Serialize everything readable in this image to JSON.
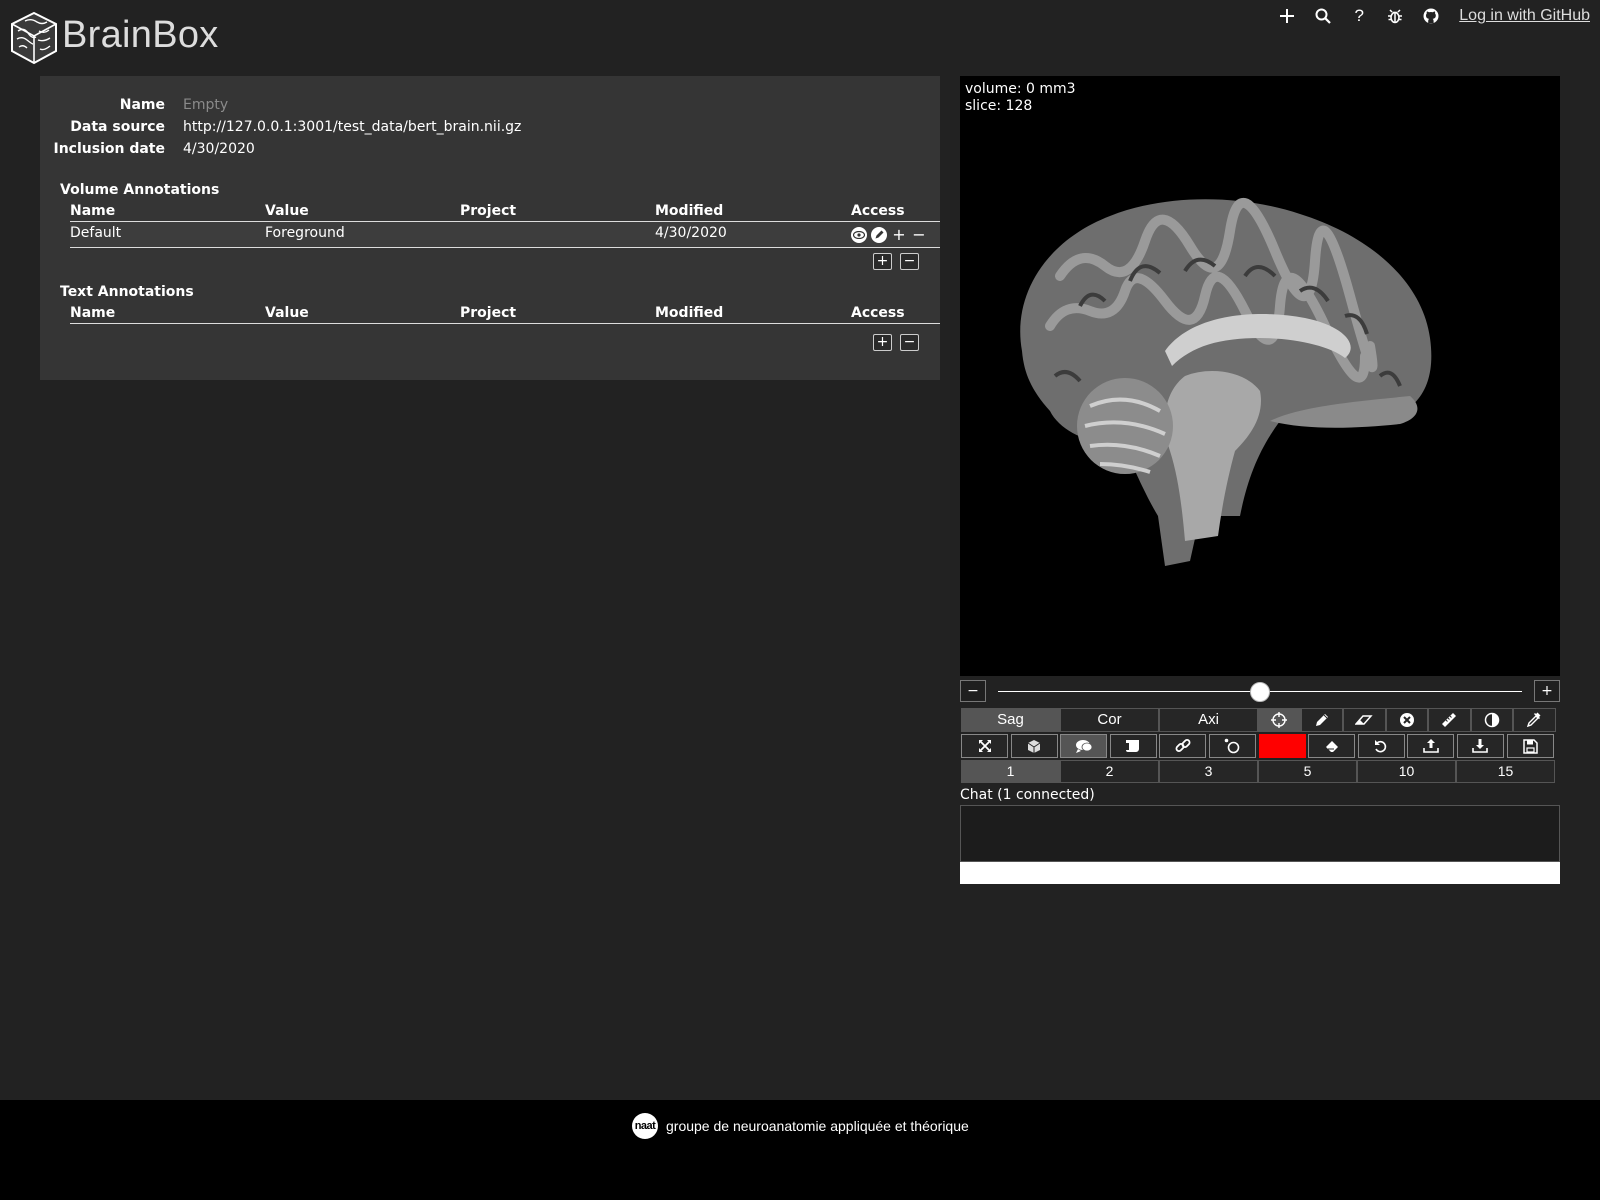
{
  "app": {
    "title": "BrainBox"
  },
  "header": {
    "icons": [
      "plus-icon",
      "search-icon",
      "help-icon",
      "bug-icon",
      "github-icon"
    ],
    "help_label": "?",
    "login_label": "Log in with GitHub"
  },
  "info": {
    "name_label": "Name",
    "name_value": "Empty",
    "source_label": "Data source",
    "source_value": "http://127.0.0.1:3001/test_data/bert_brain.nii.gz",
    "date_label": "Inclusion date",
    "date_value": "4/30/2020"
  },
  "volume_annotations": {
    "title": "Volume Annotations",
    "columns": [
      "Name",
      "Value",
      "Project",
      "Modified",
      "Access"
    ],
    "rows": [
      {
        "name": "Default",
        "value": "Foreground",
        "project": "",
        "modified": "4/30/2020"
      }
    ],
    "add_label": "+",
    "remove_label": "−"
  },
  "text_annotations": {
    "title": "Text Annotations",
    "columns": [
      "Name",
      "Value",
      "Project",
      "Modified",
      "Access"
    ],
    "rows": [],
    "add_label": "+",
    "remove_label": "−"
  },
  "viewer": {
    "volume_text": "volume: 0 mm3",
    "slice_text": "slice: 128",
    "slider": {
      "minus_label": "−",
      "plus_label": "+",
      "value_fraction": 0.5
    },
    "view_tabs": [
      {
        "label": "Sag",
        "active": true
      },
      {
        "label": "Cor",
        "active": false
      },
      {
        "label": "Axi",
        "active": false
      }
    ],
    "tools": [
      "crosshair-icon",
      "pencil-icon",
      "eraser-icon",
      "clear-icon",
      "ruler-icon",
      "contrast-icon",
      "eyedropper-icon"
    ],
    "active_tool": "crosshair-icon",
    "actions": [
      "fullscreen-icon",
      "3d-render-icon",
      "chat-icon",
      "script-icon",
      "link-icon",
      "fill-icon",
      "color-swatch",
      "paint-bucket-icon",
      "undo-icon",
      "upload-icon",
      "download-icon",
      "save-icon"
    ],
    "active_action": "chat-icon",
    "pen_color": "#ff0000",
    "pen_sizes": [
      {
        "label": "1",
        "active": true
      },
      {
        "label": "2",
        "active": false
      },
      {
        "label": "3",
        "active": false
      },
      {
        "label": "5",
        "active": false
      },
      {
        "label": "10",
        "active": false
      },
      {
        "label": "15",
        "active": false
      }
    ]
  },
  "chat": {
    "label": "Chat (1 connected)",
    "input_value": ""
  },
  "footer": {
    "logo_text": "naat",
    "text": "groupe de neuroanatomie appliquée et théorique"
  }
}
